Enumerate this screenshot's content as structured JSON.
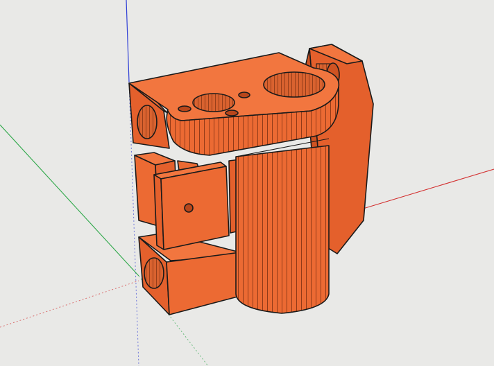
{
  "viewport": {
    "background": "#e9e9e7"
  },
  "model": {
    "name": "",
    "colors": {
      "top": "#f2763f",
      "front": "#ec6a33",
      "side": "#e4602c",
      "dark": "#cf5322",
      "hole": "#b8461b",
      "edge": "#1a1a1a"
    }
  },
  "axes": {
    "blue_axis_color": "#2f3fd6",
    "red_axis_color": "#d33030",
    "green_axis_color": "#2fa84a"
  }
}
